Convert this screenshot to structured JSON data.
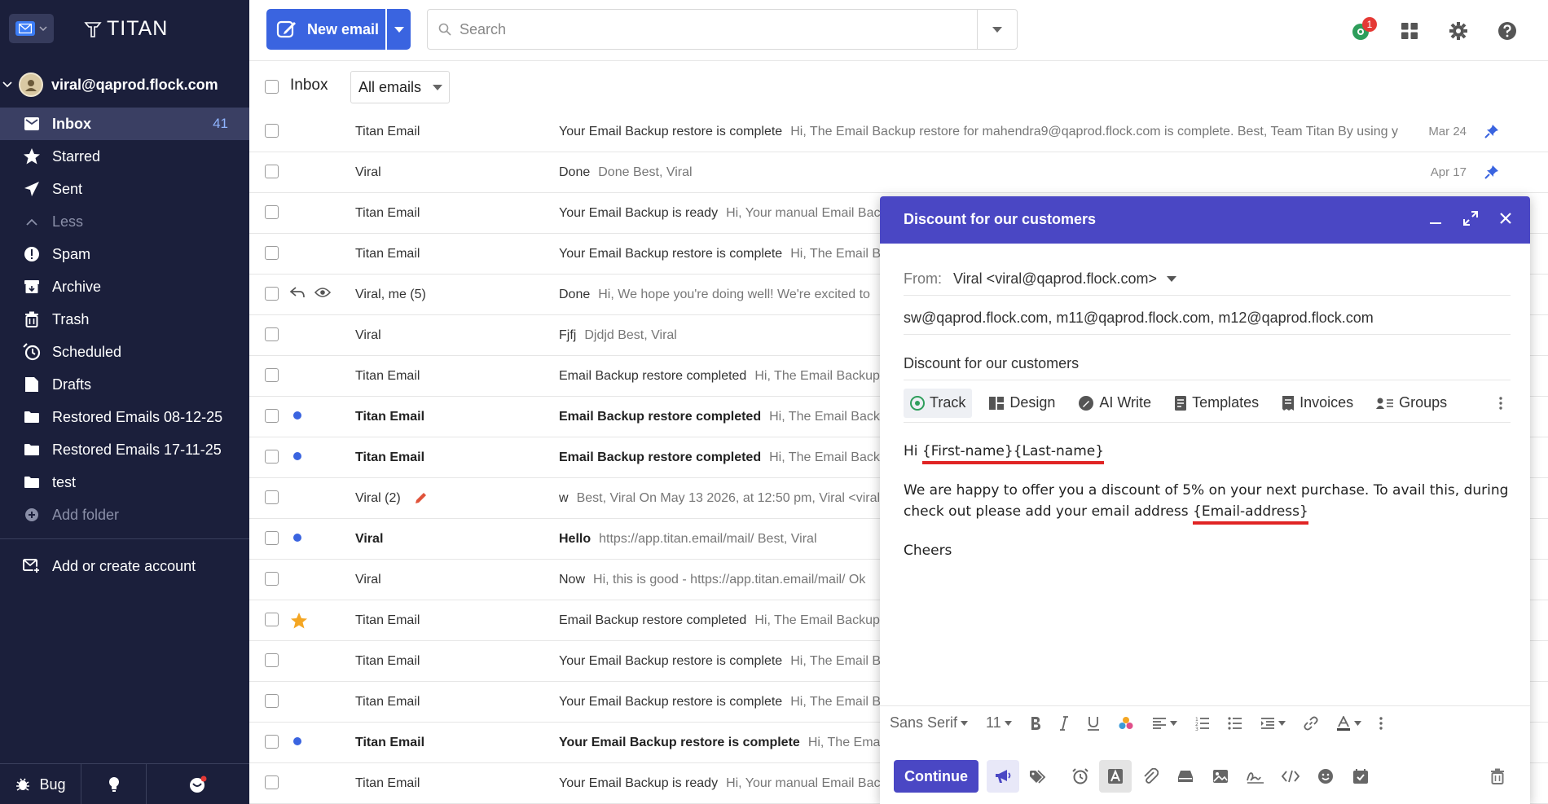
{
  "app": {
    "brand": "TITAN"
  },
  "account": {
    "email": "viral@qaprod.flock.com"
  },
  "sidebar": {
    "folders": [
      {
        "label": "Inbox",
        "count": "41",
        "icon": "inbox-icon"
      },
      {
        "label": "Starred",
        "icon": "star-icon"
      },
      {
        "label": "Sent",
        "icon": "send-icon"
      },
      {
        "label": "Less",
        "icon": "chevron-up-icon"
      },
      {
        "label": "Spam",
        "icon": "spam-icon"
      },
      {
        "label": "Archive",
        "icon": "archive-icon"
      },
      {
        "label": "Trash",
        "icon": "trash-icon"
      },
      {
        "label": "Scheduled",
        "icon": "clock-icon"
      },
      {
        "label": "Drafts",
        "icon": "drafts-icon"
      },
      {
        "label": "Restored Emails 08-12-25",
        "icon": "folder-icon"
      },
      {
        "label": "Restored Emails 17-11-25",
        "icon": "folder-icon"
      },
      {
        "label": "test",
        "icon": "folder-icon"
      },
      {
        "label": "Add folder",
        "icon": "plus-icon"
      }
    ],
    "add_account": "Add or create account",
    "bug_label": "Bug"
  },
  "topbar": {
    "new_email": "New email",
    "search_placeholder": "Search",
    "notification_count": "1"
  },
  "list": {
    "folder_label": "Inbox",
    "filter": "All emails",
    "rows": [
      {
        "sender": "Titan Email",
        "subject": "Your Email Backup restore is complete",
        "preview": "Hi, The Email Backup restore for mahendra9@qaprod.flock.com is complete. Best, Team Titan By using y",
        "date": "Mar 24",
        "pinned": true
      },
      {
        "sender": "Viral",
        "subject": "Done",
        "preview": "Done Best, Viral",
        "date": "Apr 17",
        "pinned": true
      },
      {
        "sender": "Titan Email",
        "subject": "Your Email Backup is ready",
        "preview": "Hi, Your manual Email Backup"
      },
      {
        "sender": "Titan Email",
        "subject": "Your Email Backup restore is complete",
        "preview": "Hi, The Email Backup"
      },
      {
        "sender": "Viral, me (5)",
        "subject": "Done",
        "preview": "Hi, We hope you're doing well! We're excited to"
      },
      {
        "sender": "Viral",
        "subject": "Fjfj",
        "preview": "Djdjd Best, Viral"
      },
      {
        "sender": "Titan Email",
        "subject": "Email Backup restore completed",
        "preview": "Hi, The Email Backup"
      },
      {
        "sender": "Titan Email",
        "subject": "Email Backup restore completed",
        "preview": "Hi, The Email Backup",
        "unread": true
      },
      {
        "sender": "Titan Email",
        "subject": "Email Backup restore completed",
        "preview": "Hi, The Email Backup",
        "unread": true
      },
      {
        "sender": "Viral (2)",
        "subject": "w",
        "preview": "Best, Viral On May 13 2026, at 12:50 pm, Viral <viral"
      },
      {
        "sender": "Viral",
        "subject": "Hello",
        "preview": "https://app.titan.email/mail/ Best, Viral",
        "unread": true
      },
      {
        "sender": "Viral",
        "subject": "Now",
        "preview": "Hi, this is good - https://app.titan.email/mail/ Ok"
      },
      {
        "sender": "Titan Email",
        "subject": "Email Backup restore completed",
        "preview": "Hi, The Email Backup",
        "starred": true
      },
      {
        "sender": "Titan Email",
        "subject": "Your Email Backup restore is complete",
        "preview": "Hi, The Email Backup"
      },
      {
        "sender": "Titan Email",
        "subject": "Your Email Backup restore is complete",
        "preview": "Hi, The Email Backup"
      },
      {
        "sender": "Titan Email",
        "subject": "Your Email Backup restore is complete",
        "preview": "Hi, The Email Backup",
        "unread": true
      },
      {
        "sender": "Titan Email",
        "subject": "Your Email Backup is ready",
        "preview": "Hi, Your manual Email Backup"
      }
    ]
  },
  "compose": {
    "title": "Discount for our customers",
    "from_label": "From:",
    "from_value": "Viral <viral@qaprod.flock.com>",
    "to": "sw@qaprod.flock.com, m11@qaprod.flock.com, m12@qaprod.flock.com",
    "subject": "Discount for our customers",
    "tools": [
      "Track",
      "Design",
      "AI Write",
      "Templates",
      "Invoices",
      "Groups"
    ],
    "body": {
      "greeting_prefix": "Hi ",
      "greeting_vars": "{First-name}{Last-name}",
      "para_text": "We are happy to offer you a discount of 5% on your next purchase. To avail this, during check out please add your email address ",
      "para_var": "{Email-address}",
      "closing": "Cheers"
    },
    "format": {
      "font": "Sans Serif",
      "size": "11"
    },
    "continue": "Continue"
  },
  "colors": {
    "sidebar_bg": "#1b1f3b",
    "accent": "#3a64e0",
    "compose_header": "#4a47c4",
    "highlight_underline": "#e02424"
  }
}
